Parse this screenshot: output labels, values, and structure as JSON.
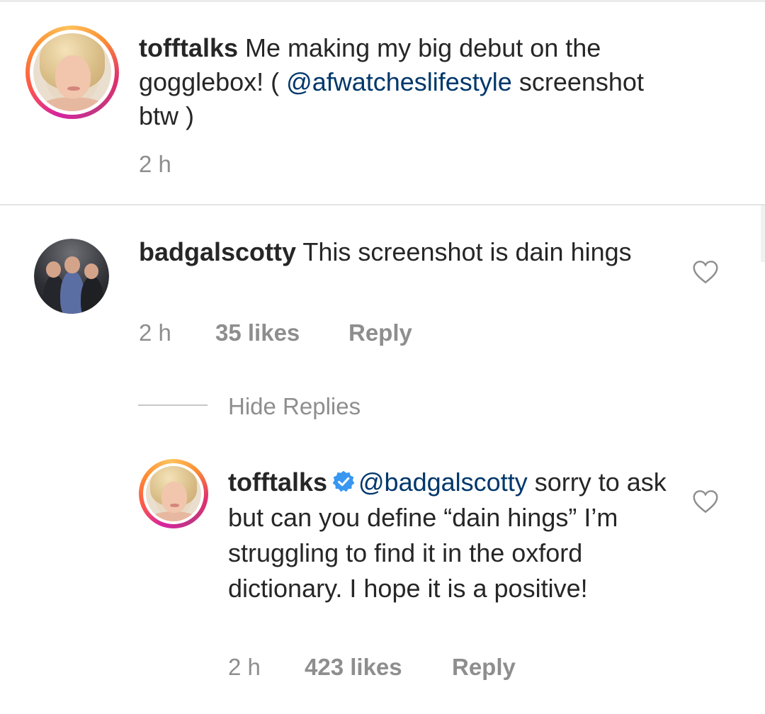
{
  "caption": {
    "username": "tofftalks",
    "text_before_mention": "Me making my big debut on the gogglebox! ( ",
    "mention": "@afwatcheslifestyle",
    "text_after_mention": " screenshot btw )",
    "time": "2 h"
  },
  "comments": [
    {
      "username": "badgalscotty",
      "text": "This screenshot is dain hings",
      "time": "2 h",
      "likes": "35 likes",
      "reply_label": "Reply",
      "hide_replies_label": "Hide Replies"
    }
  ],
  "replies": [
    {
      "username": "tofftalks",
      "mention": "@badgalscotty",
      "text": " sorry to ask but can you define “dain hings” I’m struggling to find it in the oxford dictionary. I hope it is a positive!",
      "time": "2 h",
      "likes": "423 likes",
      "reply_label": "Reply"
    }
  ],
  "icons": {
    "heart": "heart-outline-icon",
    "verified": "verified-badge-icon"
  },
  "colors": {
    "text": "#262626",
    "meta": "#8e8e8e",
    "mention": "#00376b",
    "verified": "#3897f0"
  }
}
